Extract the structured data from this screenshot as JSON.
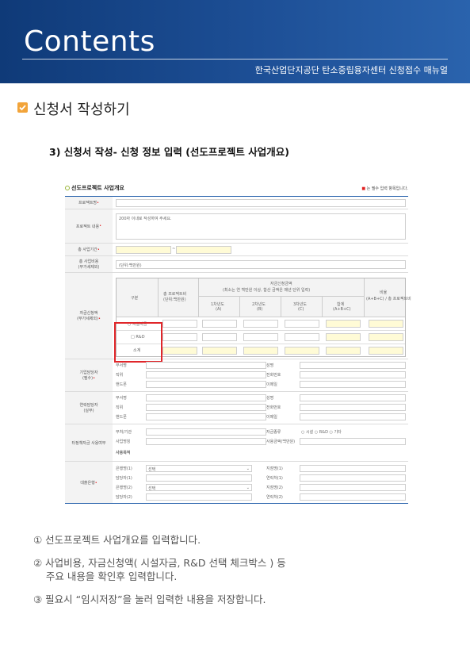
{
  "header": {
    "title": "Contents",
    "subtitle": "한국산업단지공단 탄소중립융자센터 신청접수 매뉴얼",
    "colors": {
      "bg_start": "#0f3a78",
      "bg_end": "#2a63ad",
      "text": "#ffffff"
    }
  },
  "section": {
    "icon": "checkbox-icon",
    "title": "신청서 작성하기"
  },
  "step": {
    "title": "3) 신청서 작성- 신청 정보 입력 (선도프로젝트 사업개요)"
  },
  "form": {
    "heading": "선도프로젝트 사업개요",
    "required_note": "는 필수 입력 항목입니다.",
    "required_mark": "■",
    "labels": {
      "project_name": "프로젝트명",
      "project_content": "프로젝트 내용",
      "period": "총 사업기간",
      "total_cost": "총 사업비용",
      "total_cost_unit": "(부가세제외)",
      "funding_plan": "자금신청액",
      "funding_plan_unit": "(부가세제외)",
      "contact1": "기업담당자",
      "contact1_sub": "(필수)",
      "contact2": "연락담당자",
      "contact2_sub": "(실무)",
      "other_program": "타정책자금 사용여부",
      "partners": "대출은행"
    },
    "placeholders": {
      "project_content": "200자 이내로 작성하여 주세요.",
      "total_cost": "(단위:백만원)",
      "date_sep": "~"
    },
    "funding_table": {
      "col_type": "구분",
      "col_project": "총 프로젝트비\n(단위:백만원)",
      "col_group": "자금신청금액",
      "col_group_note": "(최소는 연 백만원 이상, 합산 금액은 매년 단위 입력)",
      "years": [
        "1차년도",
        "2차년도",
        "3차년도",
        "합계"
      ],
      "year_subs": [
        "(A)",
        "(B)",
        "(C)",
        "(A+B+C)"
      ],
      "col_ratio": "비율",
      "col_ratio_note": "(A+B+C) / 총 프로젝트비",
      "rows": [
        "시설자금",
        "R&D",
        "소계"
      ]
    },
    "contact_fields": [
      "부서명",
      "직위",
      "핸드폰",
      "성명",
      "전화번호",
      "이메일"
    ],
    "other_fields": [
      "부처/기관",
      "사업명칭",
      "사용목적",
      "자금종류",
      "사용금액(백만원)"
    ],
    "fund_options": [
      "시설",
      "R&D",
      "기타"
    ],
    "bank_fields": [
      "은행명(1)",
      "담당자(1)",
      "은행명(2)",
      "담당자(2)",
      "지점명(1)",
      "연락처(1)",
      "지점명(2)",
      "연락처(2)"
    ],
    "select_placeholder": "선택"
  },
  "notes": [
    "① 선도프로젝트 사업개요를 입력합니다.",
    "② 사업비용, 자금신청액( 시설자금, R&D  선택 체크박스 ) 등",
    "    주요 내용을 확인후 입력합니다.",
    "③ 필요시 “임시저장”을 눌러 입력한 내용을 저장합니다."
  ]
}
